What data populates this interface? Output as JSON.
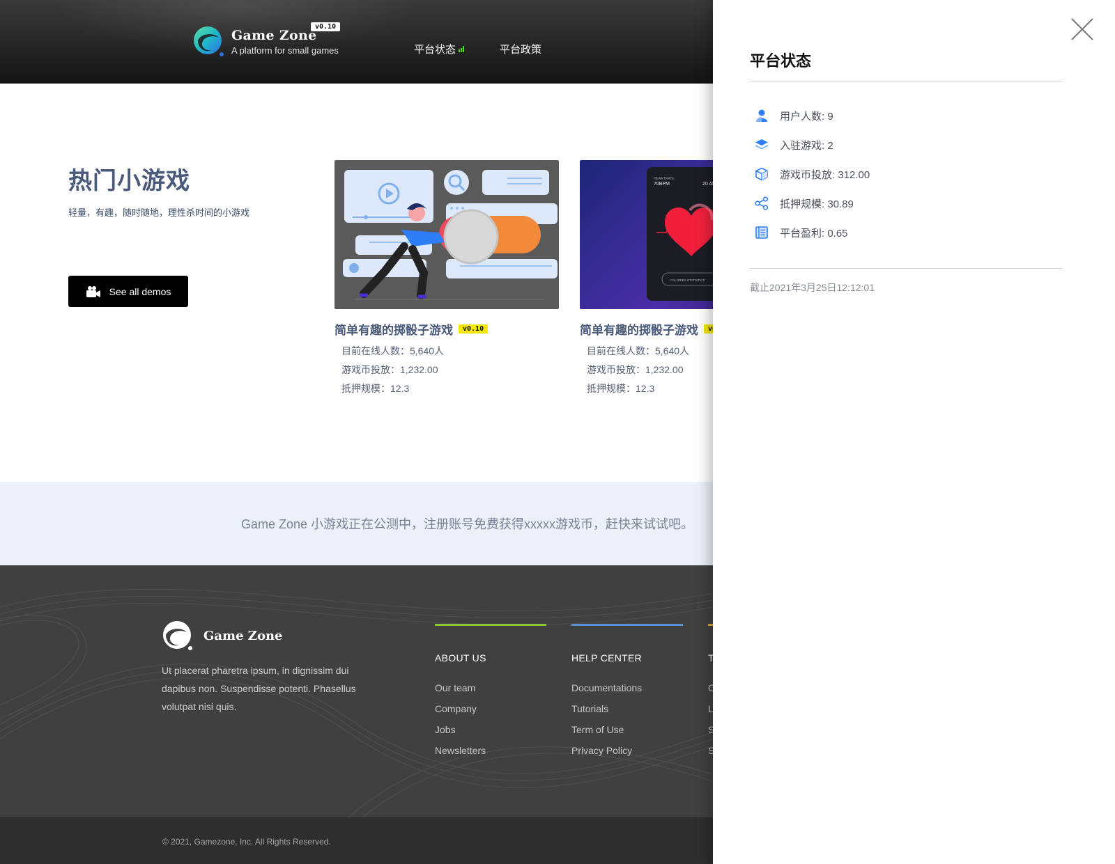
{
  "header": {
    "brand_name": "Game Zone",
    "brand_tagline": "A platform for small games",
    "version": "v0.10",
    "nav": [
      {
        "label": "平台状态",
        "icon": "signal-bars-icon"
      },
      {
        "label": "平台政策"
      }
    ]
  },
  "hero": {
    "title": "热门小游戏",
    "subtitle": "轻量，有趣，随时随地，理性杀时间的小游戏",
    "button_label": "See all demos",
    "button_icon": "video-camera-icon"
  },
  "games": [
    {
      "title": "简单有趣的掷骰子游戏",
      "badge": "v0.10",
      "stats": [
        "目前在线人数：5,640人",
        "游戏币投放：1,232.00",
        "抵押规模：12.3"
      ]
    },
    {
      "title": "简单有趣的掷骰子游戏",
      "badge": "v0.10",
      "stats": [
        "目前在线人数：5,640人",
        "游戏币投放：1,232.00",
        "抵押规模：12.3"
      ],
      "image_labels": [
        "HEARTRATE",
        "70BPM",
        "20 AP",
        "CALORIES STATISTICS"
      ]
    }
  ],
  "banner": {
    "text": "Game Zone 小游戏正在公测中，注册账号免费获得xxxxx游戏币，赶快来试试吧。"
  },
  "footer": {
    "brand_name": "Game Zone",
    "description": "Ut placerat pharetra ipsum, in dignissim dui dapibus non. Suspendisse potenti. Phasellus volutpat nisi quis.",
    "columns": [
      {
        "heading": "ABOUT US",
        "accent": "#8cc63f",
        "links": [
          "Our team",
          "Company",
          "Jobs",
          "Newsletters"
        ]
      },
      {
        "heading": "HELP CENTER",
        "accent": "#5b8fd6",
        "links": [
          "Documentations",
          "Tutorials",
          "Term of Use",
          "Privacy Policy"
        ]
      },
      {
        "heading": "T",
        "accent": "#e6a12e",
        "links": [
          "C",
          "L",
          "S",
          "S"
        ]
      }
    ],
    "copyright": "© 2021, Gamezone, Inc. All Rights Reserved."
  },
  "drawer": {
    "title": "平台状态",
    "stats": [
      {
        "label": "用户人数: 9",
        "icon": "user-icon"
      },
      {
        "label": "入驻游戏: 2",
        "icon": "layers-icon"
      },
      {
        "label": "游戏币投放: 312.00",
        "icon": "cube-icon"
      },
      {
        "label": "抵押规模: 30.89",
        "icon": "share-nodes-icon"
      },
      {
        "label": "平台盈利: 0.65",
        "icon": "ledger-icon"
      }
    ],
    "timestamp": "截止2021年3月25日12:12:01"
  },
  "colors": {
    "accent_blue": "#2f7df6",
    "badge_yellow": "#f5e800",
    "signal_green": "#59d52a"
  }
}
